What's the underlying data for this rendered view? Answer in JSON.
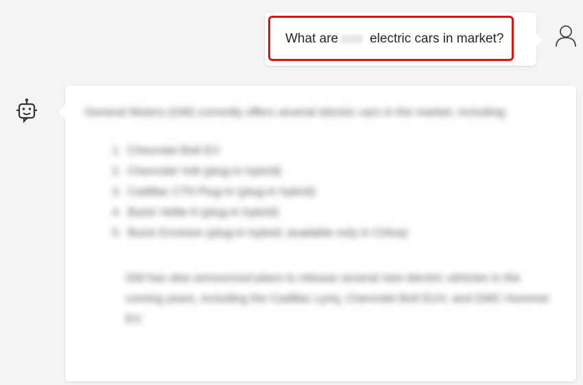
{
  "user_message": {
    "text_before": "What are",
    "text_after": "electric cars in market?",
    "highlight_color": "#e01010"
  },
  "icons": {
    "user": "user-icon",
    "bot": "bot-icon"
  },
  "bot_response": {
    "intro": "General Motors (GM) currently offers several electric cars in the market, including:",
    "items": [
      "Chevrolet Bolt EV",
      "Chevrolet Volt (plug-in hybrid)",
      "Cadillac CT6 Plug-In (plug-in hybrid)",
      "Buick Velite 6 (plug-in hybrid)",
      "Buick Envision (plug-in hybrid; available only in China)"
    ],
    "note": "GM has also announced plans to release several new electric vehicles in the coming years, including the Cadillac Lyriq, Chevrolet Bolt EUV, and GMC Hummer EV."
  }
}
